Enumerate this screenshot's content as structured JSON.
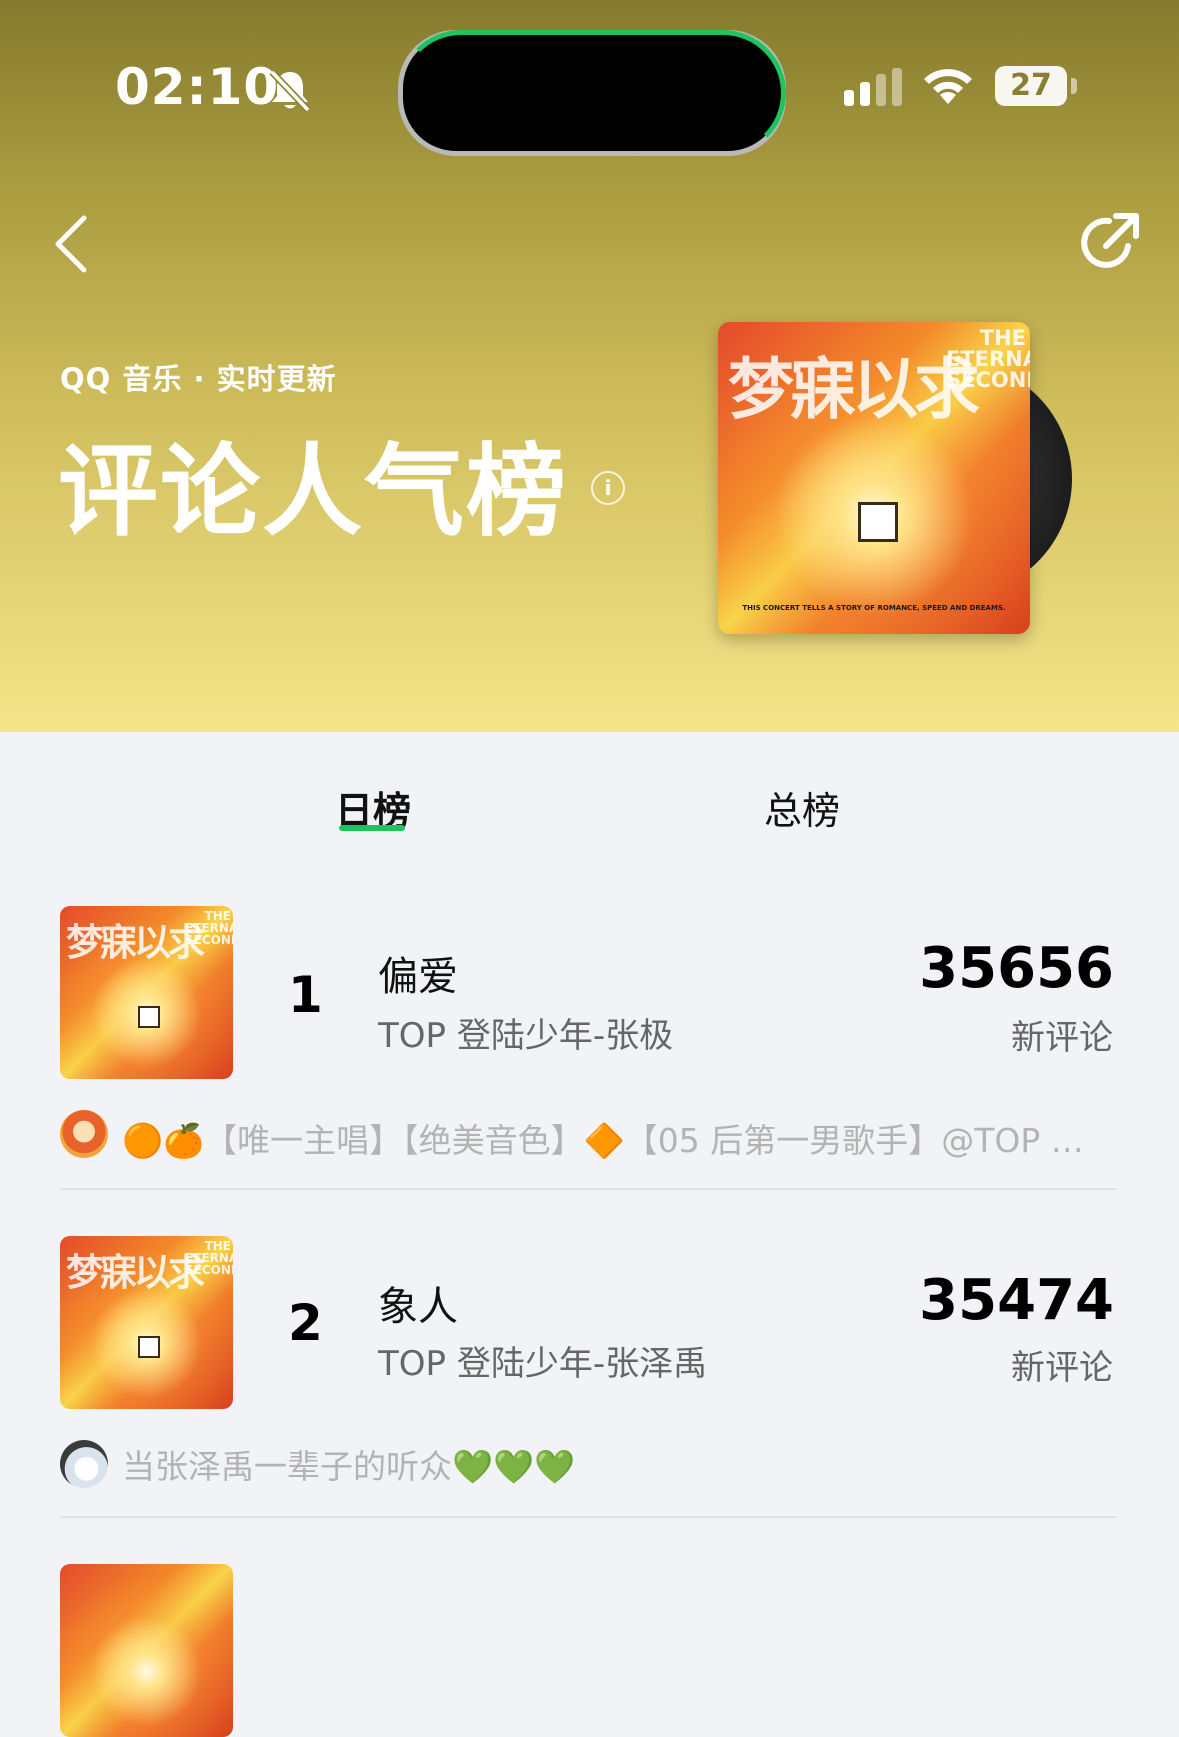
{
  "status_bar": {
    "time": "02:10",
    "battery": "27"
  },
  "header": {
    "subtitle": "QQ 音乐 · 实时更新",
    "title": "评论人气榜",
    "info_label": "i"
  },
  "album_art": {
    "cover_title": "梦寐以求",
    "cover_subtitle": "THE ETERNAL SECOND",
    "cover_tagline": "THIS CONCERT TELLS A STORY OF ROMANCE, SPEED AND DREAMS."
  },
  "tabs": [
    {
      "label": "日榜",
      "active": true
    },
    {
      "label": "总榜",
      "active": false
    }
  ],
  "entries": [
    {
      "rank": "1",
      "song": "偏爱",
      "artist": "TOP 登陆少年-张极",
      "count": "35656",
      "count_label": "新评论",
      "comment": "🟠🍊【唯一主唱】【绝美音色】🔶【05 后第一男歌手】@TOP 登陆少年-张极"
    },
    {
      "rank": "2",
      "song": "象人",
      "artist": "TOP 登陆少年-张泽禹",
      "count": "35474",
      "count_label": "新评论",
      "comment": "当张泽禹一辈子的听众💚💚💚"
    }
  ],
  "colors": {
    "accent": "#1fc45e",
    "header_top": "#857a2e",
    "header_bottom": "#f5e58a",
    "list_bg": "#f1f3f6"
  }
}
